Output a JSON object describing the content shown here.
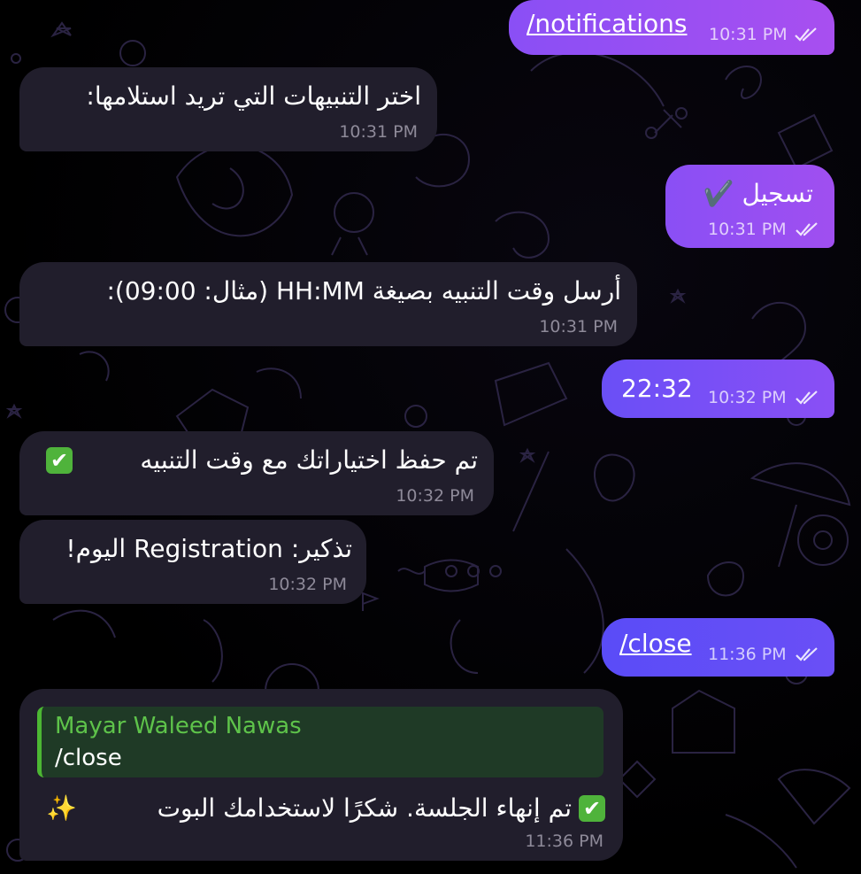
{
  "colors": {
    "background": "#000000",
    "incoming_bubble": "#211e2c",
    "outgoing_gradient_start": "#5a4cf7",
    "outgoing_gradient_end": "#a64ff0",
    "reply_accent": "#4cb733",
    "check_emoji": "#4fb33b"
  },
  "messages": [
    {
      "direction": "out",
      "text": "/notifications",
      "time": "10:31 PM",
      "status_icon": "double-check-icon"
    },
    {
      "direction": "in",
      "text": "اختر التنبيهات التي تريد استلامها:",
      "time": "10:31 PM"
    },
    {
      "direction": "out",
      "text": "تسجيل ✔️",
      "time": "10:31 PM",
      "status_icon": "double-check-icon"
    },
    {
      "direction": "in",
      "text": "أرسل وقت التنبيه بصيغة HH:MM (مثال: 09:00):",
      "time": "10:31 PM"
    },
    {
      "direction": "out",
      "text": "22:32",
      "time": "10:32 PM",
      "status_icon": "double-check-icon"
    },
    {
      "direction": "in",
      "text": "تم حفظ اختياراتك مع وقت التنبيه",
      "emoji": "✔",
      "time": "10:32 PM"
    },
    {
      "direction": "in",
      "text": "تذكير: Registration اليوم!",
      "time": "10:32 PM"
    },
    {
      "direction": "out",
      "text": "/close",
      "time": "11:36 PM",
      "status_icon": "double-check-icon"
    },
    {
      "direction": "in",
      "reply": {
        "name": "Mayar Waleed Nawas",
        "text": "/close"
      },
      "text": "تم إنهاء الجلسة. شكرًا لاستخدامك البوت",
      "emoji": "✔",
      "emoji_trailing": "✨",
      "time": "11:36 PM"
    }
  ]
}
